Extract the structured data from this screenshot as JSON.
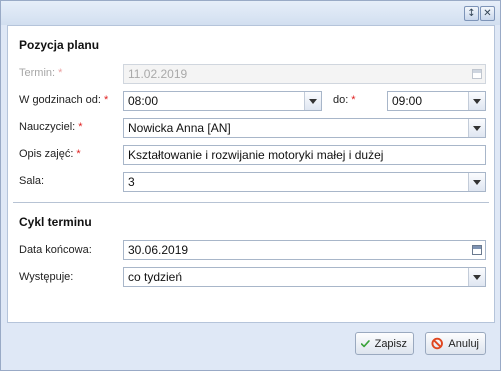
{
  "colors": {
    "frame": "#dfe8f6",
    "required_marker": "#e02020",
    "confirm_icon": "#3aa33a",
    "cancel_icon": "#e0461f"
  },
  "titlebar": {
    "icons": [
      "restore-icon",
      "close-icon"
    ]
  },
  "section_plan": {
    "title": "Pozycja planu",
    "termin": {
      "label": "Termin:",
      "value": "11.02.2019",
      "disabled": true
    },
    "hours": {
      "from_label": "W godzinach od:",
      "from_value": "08:00",
      "to_label": "do:",
      "to_value": "09:00"
    },
    "teacher": {
      "label": "Nauczyciel:",
      "value": "Nowicka Anna [AN]"
    },
    "description": {
      "label": "Opis zajęć:",
      "value": "Kształtowanie i rozwijanie motoryki małej i dużej"
    },
    "room": {
      "label": "Sala:",
      "value": "3"
    },
    "required_marker": "*"
  },
  "section_cycle": {
    "title": "Cykl terminu",
    "end_date": {
      "label": "Data końcowa:",
      "value": "30.06.2019"
    },
    "occurs": {
      "label": "Występuje:",
      "value": "co tydzień"
    }
  },
  "buttons": {
    "save": "Zapisz",
    "cancel": "Anuluj"
  }
}
